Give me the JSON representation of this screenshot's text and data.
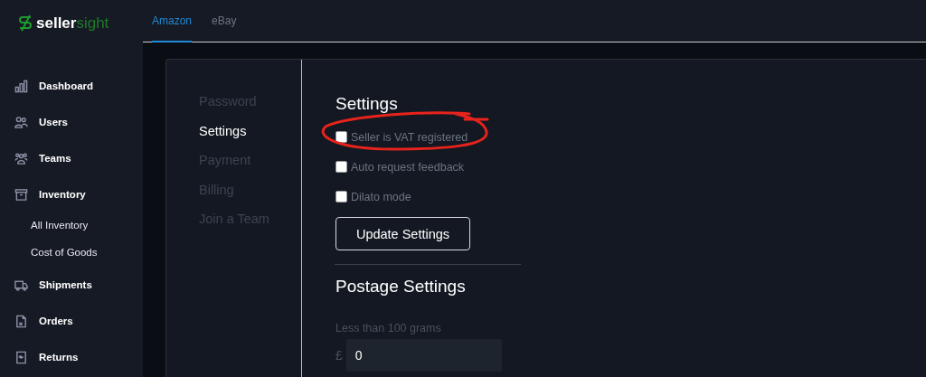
{
  "logo": {
    "bold": "seller",
    "light": "sight"
  },
  "sidebar": {
    "items": [
      {
        "kind": "main",
        "label": "Dashboard"
      },
      {
        "kind": "main",
        "label": "Users"
      },
      {
        "kind": "main",
        "label": "Teams"
      },
      {
        "kind": "main",
        "label": "Inventory"
      },
      {
        "kind": "sub",
        "label": "All Inventory"
      },
      {
        "kind": "sub",
        "label": "Cost of Goods"
      },
      {
        "kind": "main",
        "label": "Shipments"
      },
      {
        "kind": "main",
        "label": "Orders"
      },
      {
        "kind": "main",
        "label": "Returns"
      }
    ]
  },
  "tabs": [
    {
      "label": "Amazon",
      "selected": true
    },
    {
      "label": "eBay",
      "selected": false
    }
  ],
  "account_nav": [
    {
      "label": "Password",
      "selected": false
    },
    {
      "label": "Settings",
      "selected": true
    },
    {
      "label": "Payment",
      "selected": false
    },
    {
      "label": "Billing",
      "selected": false
    },
    {
      "label": "Join a Team",
      "selected": false
    }
  ],
  "settings": {
    "title": "Settings",
    "options": [
      {
        "label": "Seller is VAT registered",
        "checked": false,
        "annotated": true
      },
      {
        "label": "Auto request feedback",
        "checked": false,
        "annotated": false
      },
      {
        "label": "Dilato mode",
        "checked": false,
        "annotated": false
      }
    ],
    "button": "Update Settings"
  },
  "postage": {
    "title": "Postage Settings",
    "field_label": "Less than 100 grams",
    "currency": "£",
    "value": "0"
  }
}
